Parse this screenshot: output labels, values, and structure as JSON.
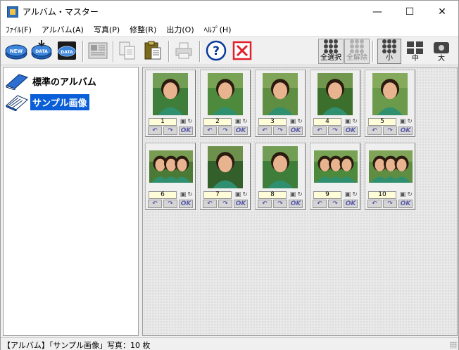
{
  "window": {
    "title": "アルバム・マスター",
    "controls": {
      "minimize": "—",
      "maximize": "☐",
      "close": "✕"
    }
  },
  "menu": [
    {
      "label": "ﾌｧｲﾙ(F)",
      "name": "menu-file"
    },
    {
      "label": "アルバム(A)",
      "name": "menu-album"
    },
    {
      "label": "写真(P)",
      "name": "menu-photo"
    },
    {
      "label": "修整(R)",
      "name": "menu-retouch"
    },
    {
      "label": "出力(O)",
      "name": "menu-output"
    },
    {
      "label": "ﾍﾙﾌﾟ(H)",
      "name": "menu-help"
    }
  ],
  "toolbar": {
    "new_icon_text": "NEW",
    "data_icon_text": "DATA",
    "help_glyph": "?",
    "select_all_label": "全選択",
    "deselect_all_label": "全解除",
    "size_small_label": "小",
    "size_medium_label": "中",
    "size_large_label": "大",
    "selected_size": "小",
    "accent_color": "#0a5fd8",
    "delete_color": "#e0202a"
  },
  "albums": [
    {
      "label": "標準のアルバム",
      "selected": false
    },
    {
      "label": "サンプル画像",
      "selected": true
    }
  ],
  "thumbnails": [
    {
      "number": "1",
      "orientation": "portrait",
      "ok": "OK"
    },
    {
      "number": "2",
      "orientation": "portrait",
      "ok": "OK"
    },
    {
      "number": "3",
      "orientation": "portrait",
      "ok": "OK"
    },
    {
      "number": "4",
      "orientation": "portrait",
      "ok": "OK"
    },
    {
      "number": "5",
      "orientation": "portrait",
      "ok": "OK"
    },
    {
      "number": "6",
      "orientation": "landscape",
      "ok": "OK"
    },
    {
      "number": "7",
      "orientation": "portrait",
      "ok": "OK"
    },
    {
      "number": "8",
      "orientation": "portrait",
      "ok": "OK"
    },
    {
      "number": "9",
      "orientation": "landscape",
      "ok": "OK"
    },
    {
      "number": "10",
      "orientation": "landscape",
      "ok": "OK"
    }
  ],
  "status": {
    "text": "【アルバム】「サンプル画像」写真：10 枚"
  }
}
